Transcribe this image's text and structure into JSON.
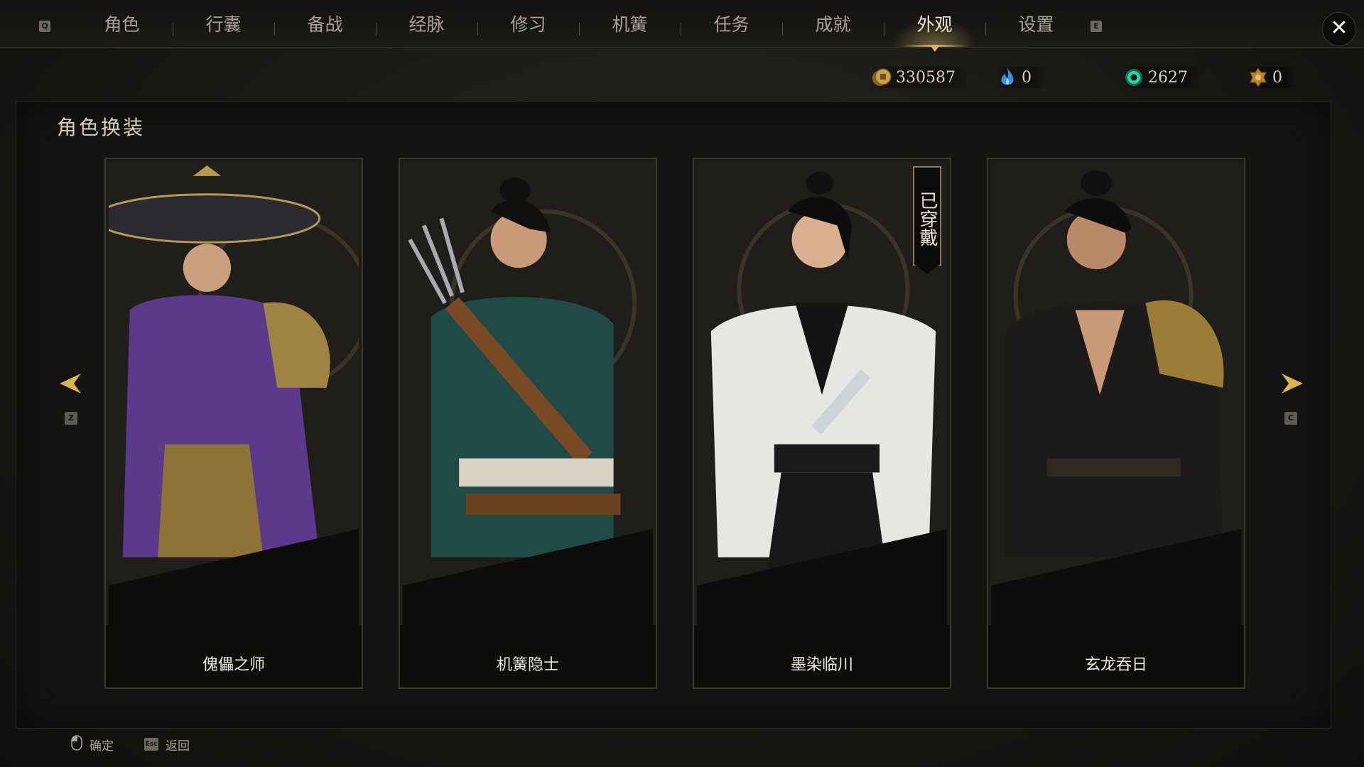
{
  "nav": {
    "prev_key": "Q",
    "next_key": "E",
    "tabs": [
      "角色",
      "行囊",
      "备战",
      "经脉",
      "修习",
      "机簧",
      "任务",
      "成就",
      "外观",
      "设置"
    ],
    "active_tab": "外观",
    "close_icon": "close-icon"
  },
  "currencies": [
    {
      "icon": "copper-coin-icon",
      "value": "330587",
      "color": "#c9a14a"
    },
    {
      "icon": "blue-flame-icon",
      "value": "0",
      "color": "#3f8fe0"
    },
    {
      "icon": "jade-ring-icon",
      "value": "2627",
      "color": "#2fd0a0"
    },
    {
      "icon": "gold-token-icon",
      "value": "0",
      "color": "#b8862e"
    }
  ],
  "panel": {
    "title": "角色换装"
  },
  "outfits": [
    {
      "name": "傀儡之师",
      "accent": "#5b3a8c",
      "equipped": false
    },
    {
      "name": "机簧隐士",
      "accent": "#1f4a45",
      "equipped": false
    },
    {
      "name": "墨染临川",
      "accent": "#e6e6e2",
      "equipped": true,
      "equipped_label": "已穿戴"
    },
    {
      "name": "玄龙吞日",
      "accent": "#1c1b19",
      "equipped": false
    }
  ],
  "carousel": {
    "prev_key": "Z",
    "next_key": "C",
    "arrow_color": "#d9b44a"
  },
  "footer": {
    "confirm_label": "确定",
    "back_key": "Esc",
    "back_label": "返回"
  }
}
